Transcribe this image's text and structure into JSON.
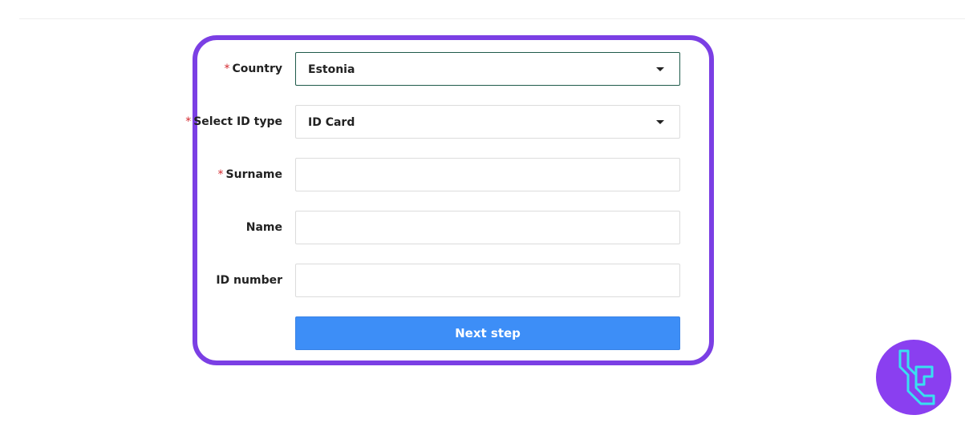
{
  "form": {
    "country": {
      "label": "Country",
      "required_mark": "*",
      "value": "Estonia"
    },
    "id_type": {
      "label": "Select ID type",
      "required_mark": "*",
      "value": "ID Card"
    },
    "surname": {
      "label": "Surname",
      "required_mark": "*",
      "value": ""
    },
    "name": {
      "label": "Name",
      "value": ""
    },
    "id_number": {
      "label": "ID number",
      "value": ""
    },
    "next_button_label": "Next step"
  },
  "colors": {
    "frame_accent": "#7b3fe4",
    "button": "#3d8ef7",
    "required": "#d4282e",
    "logo_bg": "#8a3ff0",
    "logo_stroke": "#38e0f0"
  },
  "icons": {
    "dropdown": "caret-down-icon",
    "logo": "tc-logo-icon"
  }
}
